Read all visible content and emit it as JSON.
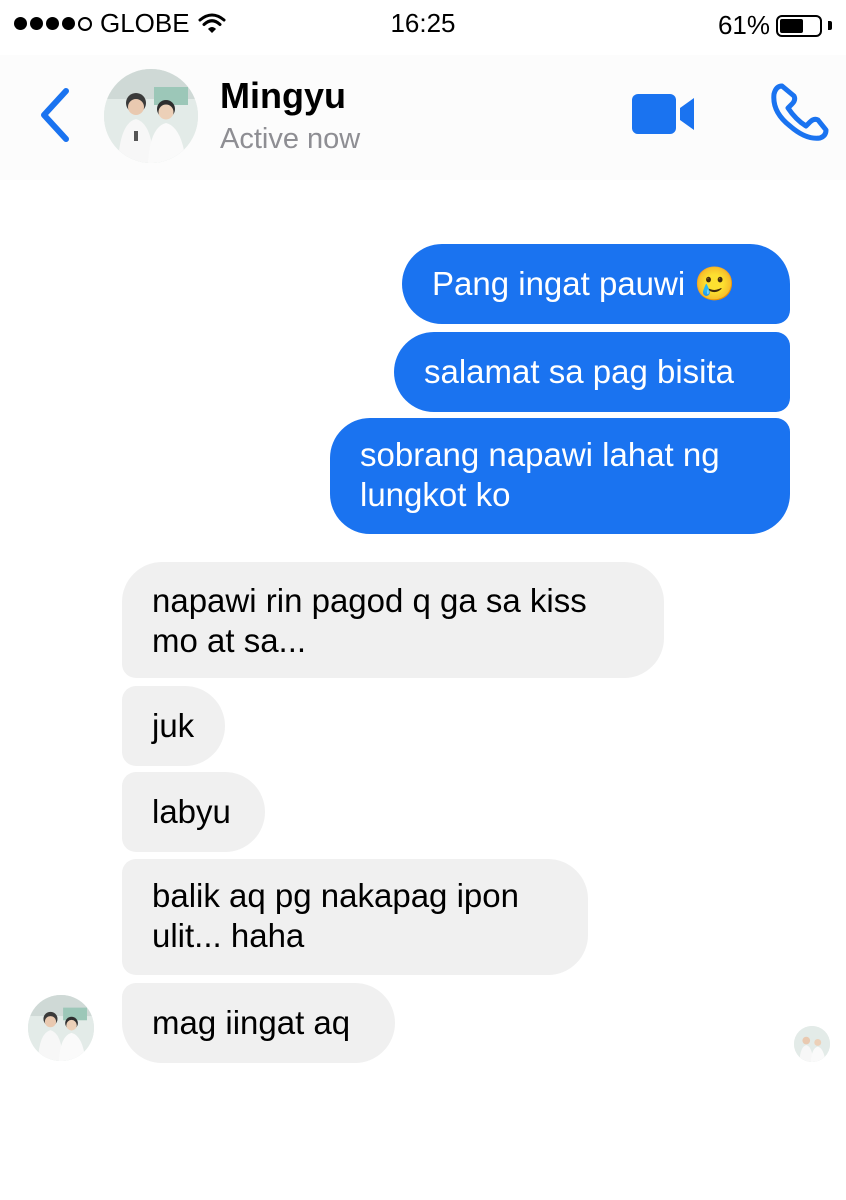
{
  "status_bar": {
    "carrier": "GLOBE",
    "time": "16:25",
    "battery_pct": "61%",
    "battery_level": 0.61
  },
  "header": {
    "contact_name": "Mingyu",
    "contact_status": "Active now",
    "back_icon": "chevron-left-icon",
    "video_icon": "video-camera-icon",
    "call_icon": "phone-icon",
    "accent_color": "#1a73f0"
  },
  "messages": [
    {
      "direction": "outgoing",
      "text": "Pang ingat pauwi 🥲"
    },
    {
      "direction": "outgoing",
      "text": "salamat sa pag bisita"
    },
    {
      "direction": "outgoing",
      "text": "sobrang napawi lahat ng\nlungkot ko"
    },
    {
      "direction": "incoming",
      "text": "napawi rin pagod q ga sa kiss\nmo at sa..."
    },
    {
      "direction": "incoming",
      "text": "juk"
    },
    {
      "direction": "incoming",
      "text": "labyu"
    },
    {
      "direction": "incoming",
      "text": "balik aq pg nakapag ipon\nulit... haha"
    },
    {
      "direction": "incoming",
      "text": "mag iingat aq"
    }
  ]
}
